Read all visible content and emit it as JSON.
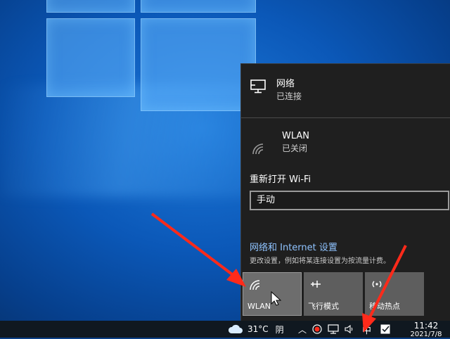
{
  "network": {
    "title": "网络",
    "status": "已连接"
  },
  "wlan": {
    "title": "WLAN",
    "status": "已关闭"
  },
  "reopen_wifi": {
    "label": "重新打开 Wi-Fi",
    "selected": "手动"
  },
  "settings": {
    "link": "网络和 Internet 设置",
    "description": "更改设置，例如将某连接设置为按流量计费。"
  },
  "tiles": [
    {
      "label": "WLAN",
      "icon": "wifi-icon"
    },
    {
      "label": "飞行模式",
      "icon": "airplane-icon"
    },
    {
      "label": "移动热点",
      "icon": "hotspot-icon"
    }
  ],
  "taskbar": {
    "weather": {
      "temp": "31°C",
      "condition": "阴",
      "icon": "cloud-icon"
    },
    "ime": "中",
    "time": "11:42",
    "date": "2021/7/8"
  },
  "colors": {
    "accent_link": "#8fc3ff",
    "arrow": "#ff2a1a",
    "taskbar": "#101820"
  }
}
